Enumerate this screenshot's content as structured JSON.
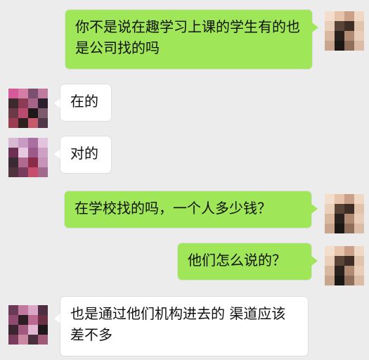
{
  "messages": [
    {
      "side": "right",
      "text": "你不是说在趣学习上课的学生有的也是公司找的吗"
    },
    {
      "side": "left",
      "text": "在的"
    },
    {
      "side": "left",
      "text": "对的"
    },
    {
      "side": "right",
      "text": "在学校找的吗，一个人多少钱？"
    },
    {
      "side": "right",
      "text": "他们怎么说的？"
    },
    {
      "side": "left",
      "text": "也是通过他们机构进去的 渠道应该差不多"
    }
  ],
  "colors": {
    "background": "#ececec",
    "sent_bubble": "#9fe658",
    "received_bubble": "#ffffff"
  }
}
